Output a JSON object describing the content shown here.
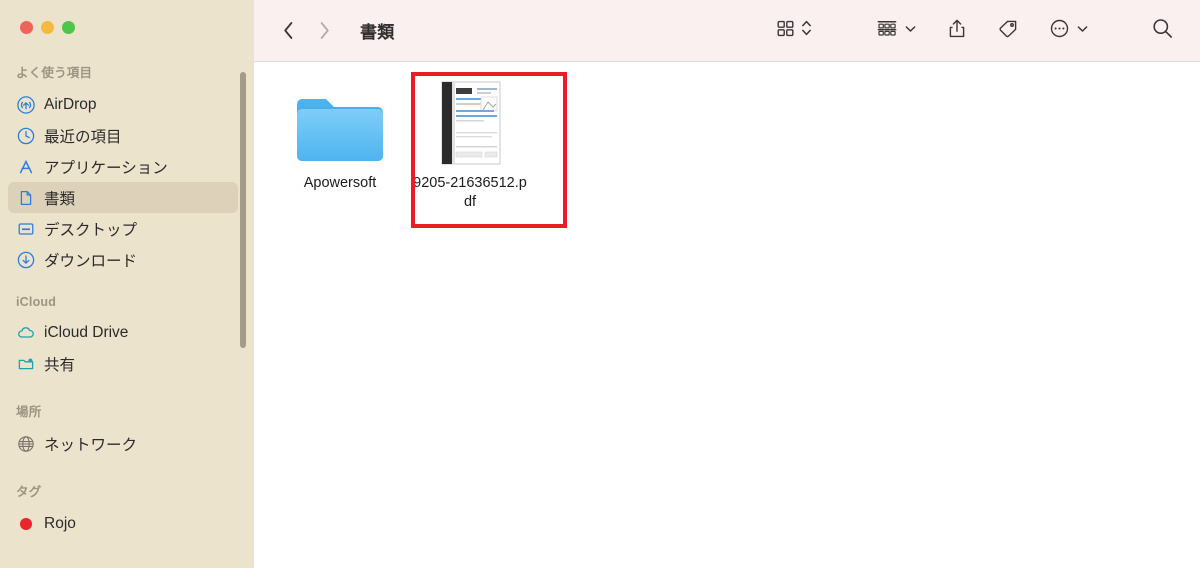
{
  "window": {
    "traffic_lights": [
      {
        "name": "close",
        "color": "#f0625a"
      },
      {
        "name": "minimize",
        "color": "#f2bb3d"
      },
      {
        "name": "maximize",
        "color": "#4ec54b"
      }
    ]
  },
  "toolbar": {
    "back_icon": "chevron-left-icon",
    "forward_icon": "chevron-right-icon",
    "title": "書類",
    "view_icon": "icon-view-grid-icon",
    "view_stepper_icon": "chevron-up-down-icon",
    "group_icon": "group-by-rows-icon",
    "group_chevron_icon": "chevron-down-icon",
    "share_icon": "share-icon",
    "tag_icon": "tag-icon",
    "more_icon": "ellipsis-circle-icon",
    "more_chevron_icon": "chevron-down-icon",
    "search_icon": "search-icon"
  },
  "sidebar": {
    "sections": [
      {
        "title": "よく使う項目",
        "items": [
          {
            "label": "AirDrop",
            "icon": "airdrop-icon",
            "selected": false
          },
          {
            "label": "最近の項目",
            "icon": "clock-icon",
            "selected": false
          },
          {
            "label": "アプリケーション",
            "icon": "applications-icon",
            "selected": false
          },
          {
            "label": "書類",
            "icon": "document-icon",
            "selected": true
          },
          {
            "label": "デスクトップ",
            "icon": "desktop-icon",
            "selected": false
          },
          {
            "label": "ダウンロード",
            "icon": "downloads-icon",
            "selected": false
          }
        ]
      },
      {
        "title": "iCloud",
        "items": [
          {
            "label": "iCloud Drive",
            "icon": "cloud-icon",
            "selected": false
          },
          {
            "label": "共有",
            "icon": "shared-folder-icon",
            "selected": false
          }
        ]
      },
      {
        "title": "場所",
        "items": [
          {
            "label": "ネットワーク",
            "icon": "globe-icon",
            "selected": false
          }
        ]
      },
      {
        "title": "タグ",
        "items": [
          {
            "label": "Rojo",
            "icon": "tag-dot-icon",
            "color": "#e8262b",
            "selected": false
          }
        ]
      }
    ]
  },
  "content": {
    "files": [
      {
        "name": "Apowersoft",
        "kind": "folder",
        "icon": "blue-folder-icon",
        "highlighted": false
      },
      {
        "name": "9205-21636512.pdf",
        "kind": "pdf",
        "icon": "pdf-document-thumbnail",
        "highlighted": true
      }
    ],
    "highlight_color": "#ec1c24"
  }
}
